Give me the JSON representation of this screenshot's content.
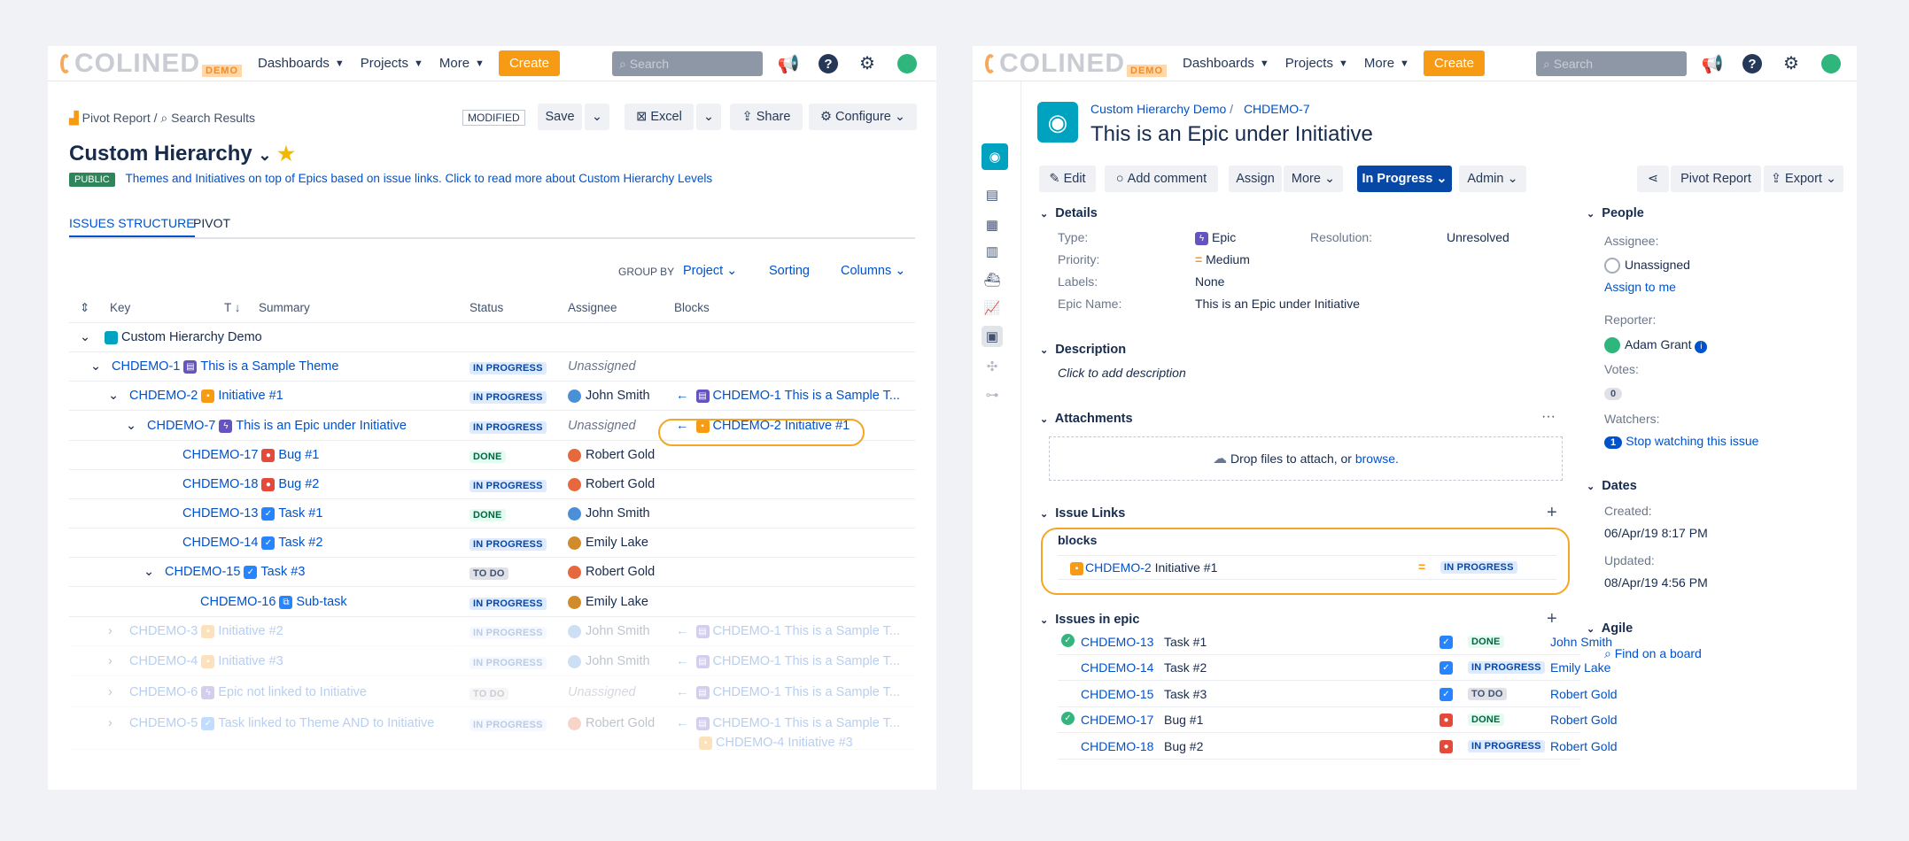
{
  "nav": {
    "logo_text": "COLINED",
    "logo_demo": "DEMO",
    "dashboards": "Dashboards",
    "projects": "Projects",
    "more": "More",
    "create": "Create",
    "search_placeholder": "Search"
  },
  "left": {
    "breadcrumb_pivot": "Pivot Report /",
    "breadcrumb_search": "Search Results",
    "modified": "MODIFIED",
    "save": "Save",
    "excel": "Excel",
    "share": "Share",
    "configure": "Configure",
    "title": "Custom Hierarchy",
    "public": "PUBLIC",
    "description": "Themes and Initiatives on top of Epics based on issue links. Click to read more about Custom Hierarchy Levels",
    "tab_structure": "ISSUES STRUCTURE",
    "tab_pivot": "PIVOT",
    "group_by_label": "GROUP BY",
    "group_by_value": "Project",
    "sorting": "Sorting",
    "columns": "Columns",
    "headers": {
      "key": "Key",
      "t": "T",
      "summary": "Summary",
      "status": "Status",
      "assignee": "Assignee",
      "blocks": "Blocks"
    },
    "project_row": "Custom Hierarchy Demo",
    "rows": [
      {
        "key": "CHDEMO-1",
        "summary": "This is a Sample Theme",
        "status": "IN PROGRESS",
        "assignee": "Unassigned",
        "blocks": ""
      },
      {
        "key": "CHDEMO-2",
        "summary": "Initiative #1",
        "status": "IN PROGRESS",
        "assignee": "John Smith",
        "blocks": "CHDEMO-1 This is a Sample T..."
      },
      {
        "key": "CHDEMO-7",
        "summary": "This is an Epic under Initiative",
        "status": "IN PROGRESS",
        "assignee": "Unassigned",
        "blocks": "CHDEMO-2 Initiative #1"
      },
      {
        "key": "CHDEMO-17",
        "summary": "Bug #1",
        "status": "DONE",
        "assignee": "Robert Gold",
        "blocks": ""
      },
      {
        "key": "CHDEMO-18",
        "summary": "Bug #2",
        "status": "IN PROGRESS",
        "assignee": "Robert Gold",
        "blocks": ""
      },
      {
        "key": "CHDEMO-13",
        "summary": "Task #1",
        "status": "DONE",
        "assignee": "John Smith",
        "blocks": ""
      },
      {
        "key": "CHDEMO-14",
        "summary": "Task #2",
        "status": "IN PROGRESS",
        "assignee": "Emily Lake",
        "blocks": ""
      },
      {
        "key": "CHDEMO-15",
        "summary": "Task #3",
        "status": "TO DO",
        "assignee": "Robert Gold",
        "blocks": ""
      },
      {
        "key": "CHDEMO-16",
        "summary": "Sub-task",
        "status": "IN PROGRESS",
        "assignee": "Emily Lake",
        "blocks": ""
      },
      {
        "key": "CHDEMO-3",
        "summary": "Initiative #2",
        "status": "IN PROGRESS",
        "assignee": "John Smith",
        "blocks": "CHDEMO-1 This is a Sample T..."
      },
      {
        "key": "CHDEMO-4",
        "summary": "Initiative #3",
        "status": "IN PROGRESS",
        "assignee": "John Smith",
        "blocks": "CHDEMO-1 This is a Sample T..."
      },
      {
        "key": "CHDEMO-6",
        "summary": "Epic not linked to Initiative",
        "status": "TO DO",
        "assignee": "Unassigned",
        "blocks": "CHDEMO-1 This is a Sample T..."
      },
      {
        "key": "CHDEMO-5",
        "summary": "Task linked to Theme AND to Initiative",
        "status": "IN PROGRESS",
        "assignee": "Robert Gold",
        "blocks": "CHDEMO-1 This is a Sample T...",
        "blocks2": "CHDEMO-4 Initiative #3"
      }
    ]
  },
  "right": {
    "breadcrumb_project": "Custom Hierarchy Demo",
    "breadcrumb_issue": "CHDEMO-7",
    "title": "This is an Epic under Initiative",
    "edit": "Edit",
    "add_comment": "Add comment",
    "assign": "Assign",
    "more": "More",
    "status": "In Progress",
    "admin": "Admin",
    "pivot_report": "Pivot Report",
    "export": "Export",
    "details_h": "Details",
    "type_l": "Type:",
    "type_v": "Epic",
    "resolution_l": "Resolution:",
    "resolution_v": "Unresolved",
    "priority_l": "Priority:",
    "priority_v": "Medium",
    "labels_l": "Labels:",
    "labels_v": "None",
    "epic_name_l": "Epic Name:",
    "epic_name_v": "This is an Epic under Initiative",
    "description_h": "Description",
    "description_v": "Click to add description",
    "attachments_h": "Attachments",
    "drop_text": "Drop files to attach, or",
    "browse": "browse.",
    "issue_links_h": "Issue Links",
    "blocks_h": "blocks",
    "link_key": "CHDEMO-2",
    "link_summary": "Initiative #1",
    "link_status": "IN PROGRESS",
    "issues_in_epic_h": "Issues in epic",
    "epic_issues": [
      {
        "key": "CHDEMO-13",
        "summary": "Task #1",
        "status": "DONE",
        "assignee": "John Smith"
      },
      {
        "key": "CHDEMO-14",
        "summary": "Task #2",
        "status": "IN PROGRESS",
        "assignee": "Emily Lake"
      },
      {
        "key": "CHDEMO-15",
        "summary": "Task #3",
        "status": "TO DO",
        "assignee": "Robert Gold"
      },
      {
        "key": "CHDEMO-17",
        "summary": "Bug #1",
        "status": "DONE",
        "assignee": "Robert Gold"
      },
      {
        "key": "CHDEMO-18",
        "summary": "Bug #2",
        "status": "IN PROGRESS",
        "assignee": "Robert Gold"
      }
    ],
    "people_h": "People",
    "assignee_l": "Assignee:",
    "assignee_v": "Unassigned",
    "assign_to_me": "Assign to me",
    "reporter_l": "Reporter:",
    "reporter_v": "Adam Grant",
    "votes_l": "Votes:",
    "votes_v": "0",
    "watchers_l": "Watchers:",
    "watchers_count": "1",
    "stop_watching": "Stop watching this issue",
    "dates_h": "Dates",
    "created_l": "Created:",
    "created_v": "06/Apr/19 8:17 PM",
    "updated_l": "Updated:",
    "updated_v": "08/Apr/19 4:56 PM",
    "agile_h": "Agile",
    "find_board": "Find on a board"
  }
}
